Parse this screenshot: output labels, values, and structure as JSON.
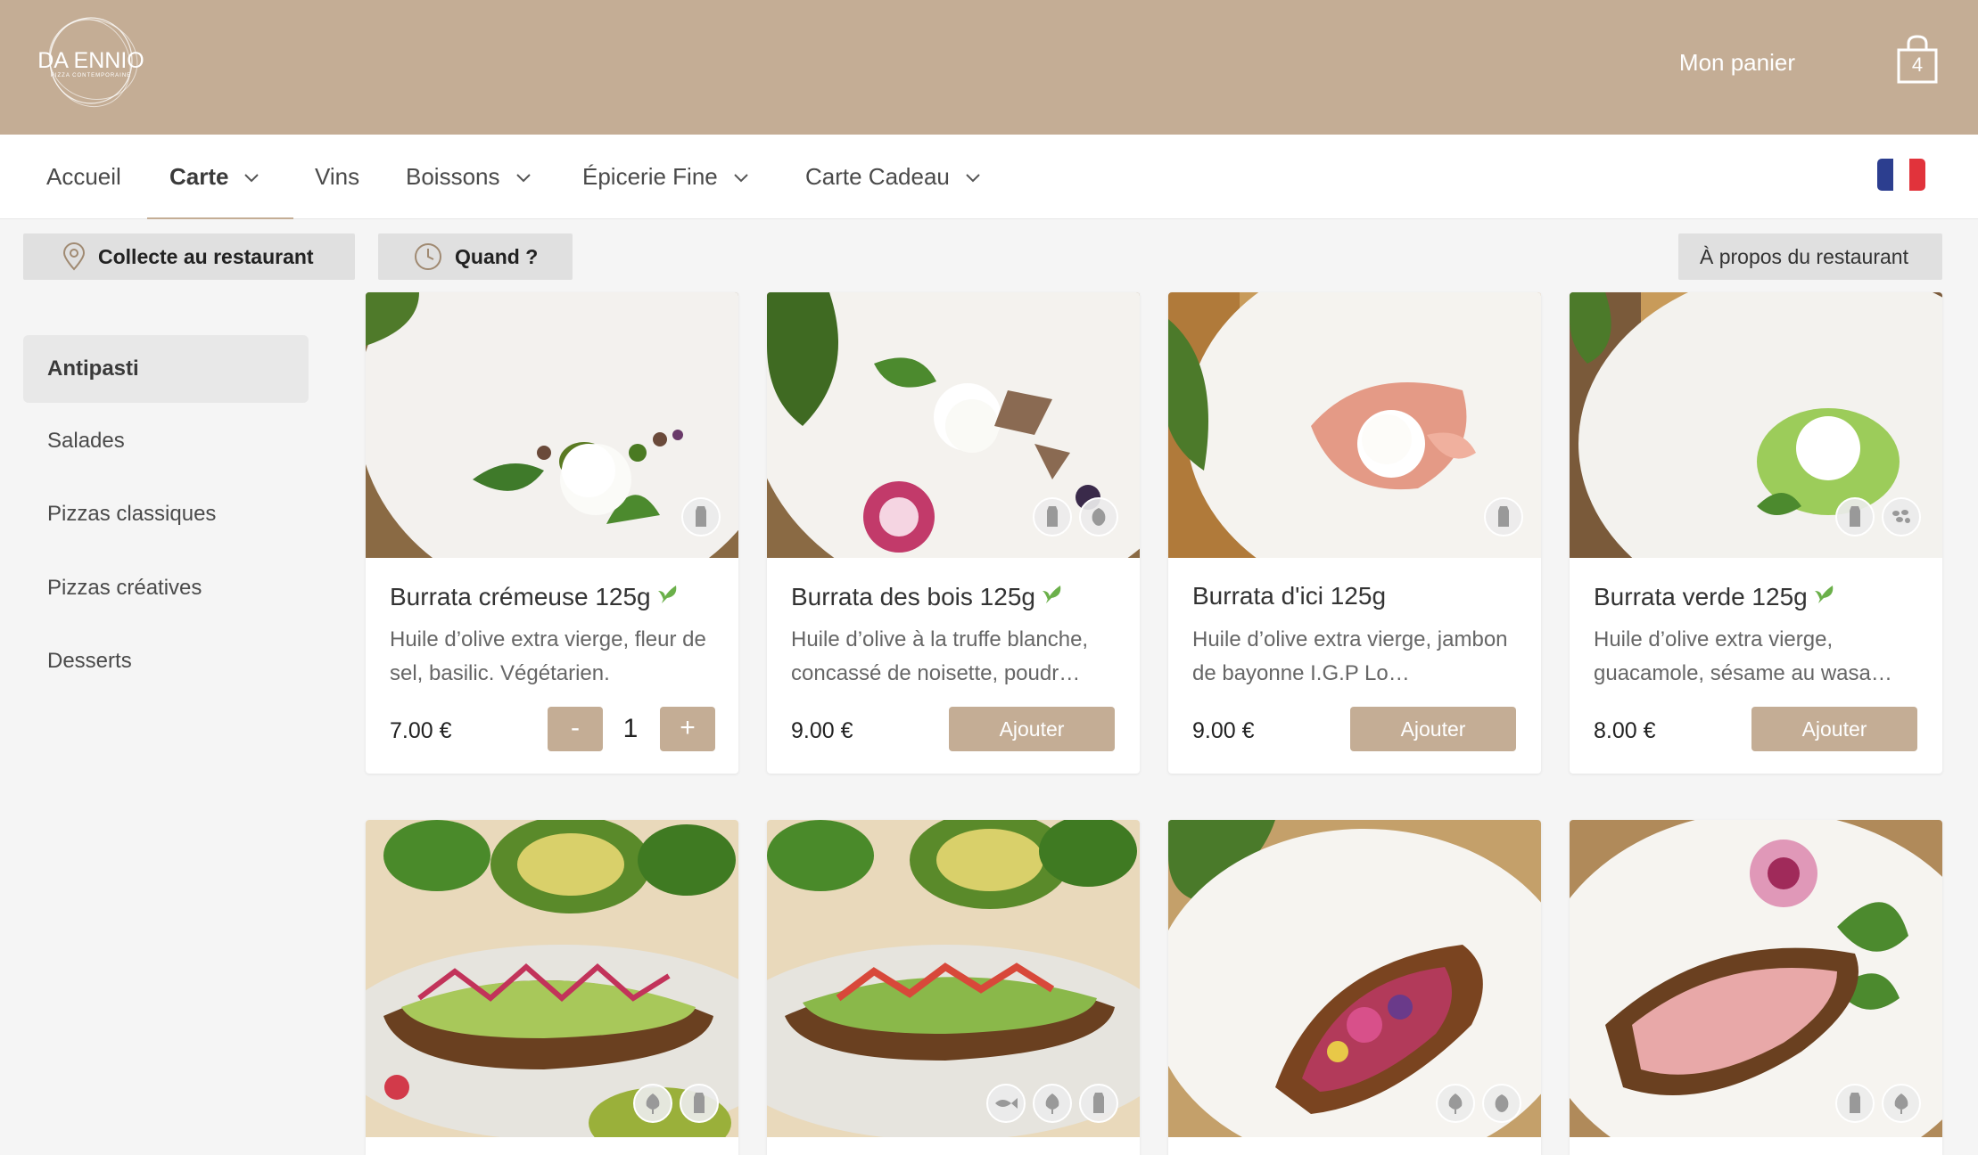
{
  "header": {
    "logo_text": "DA ENNIO",
    "logo_sub": "PIZZA CONTEMPORAINE",
    "cart_label": "Mon panier",
    "cart_count": "4"
  },
  "nav": {
    "items": [
      {
        "label": "Accueil"
      },
      {
        "label": "Carte"
      },
      {
        "label": "Vins"
      },
      {
        "label": "Boissons"
      },
      {
        "label": "Épicerie Fine"
      },
      {
        "label": "Carte Cadeau"
      }
    ]
  },
  "actions": {
    "pickup": "Collecte au restaurant",
    "when": "Quand ?",
    "about": "À propos du restaurant"
  },
  "sidebar": {
    "items": [
      {
        "label": "Antipasti"
      },
      {
        "label": "Salades"
      },
      {
        "label": "Pizzas classiques"
      },
      {
        "label": "Pizzas créatives"
      },
      {
        "label": "Desserts"
      }
    ]
  },
  "products": [
    {
      "title": "Burrata crémeuse 125g",
      "desc": "Huile d’olive extra vierge, fleur de sel, basilic. Végétarien.",
      "price": "7.00 €",
      "qty": "1",
      "minus": "-",
      "plus": "+"
    },
    {
      "title": "Burrata des bois 125g",
      "desc": "Huile d’olive à la truffe blanche, concassé de noisette, poudr…",
      "price": "9.00 €",
      "button": "Ajouter"
    },
    {
      "title": "Burrata d'ici 125g",
      "desc": "Huile d’olive extra vierge, jambon de bayonne I.G.P Lo…",
      "price": "9.00 €",
      "button": "Ajouter"
    },
    {
      "title": "Burrata verde 125g",
      "desc": "Huile d’olive extra vierge, guacamole, sésame au wasa…",
      "price": "8.00 €",
      "button": "Ajouter"
    }
  ],
  "colors": {
    "brand": "#c4ad95",
    "leaf": "#6bb04a"
  },
  "icons": {
    "leaf": "🌱",
    "chevron": "⌄",
    "location": "location-icon",
    "clock": "clock-icon",
    "cart": "shopping-bag-icon"
  }
}
